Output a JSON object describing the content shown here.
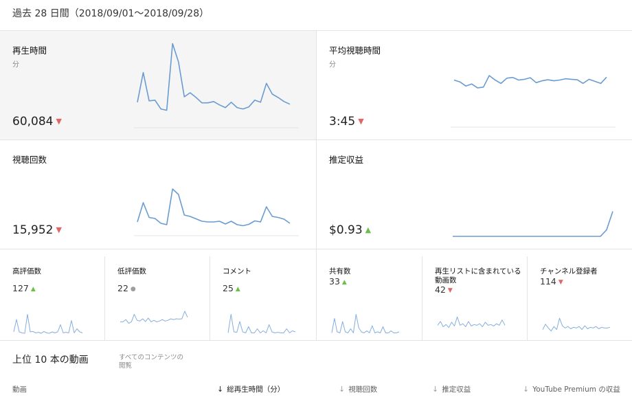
{
  "period": "過去 28 日間（2018/09/01〜2018/09/28）",
  "cards": [
    {
      "title": "再生時間",
      "unit": "分",
      "value": "60,084",
      "trend": "down"
    },
    {
      "title": "平均視聴時間",
      "unit": "分",
      "value": "3:45",
      "trend": "down"
    },
    {
      "title": "視聴回数",
      "unit": "",
      "value": "15,952",
      "trend": "down"
    },
    {
      "title": "推定収益",
      "unit": "",
      "value": "$0.93",
      "trend": "up"
    }
  ],
  "mini_cards": [
    {
      "title": "高評価数",
      "value": "127",
      "trend": "up"
    },
    {
      "title": "低評価数",
      "value": "22",
      "trend": "neutral"
    },
    {
      "title": "コメント",
      "value": "25",
      "trend": "up"
    },
    {
      "title": "共有数",
      "value": "33",
      "trend": "up"
    },
    {
      "title": "再生リストに含まれている\n動画数",
      "value": "42",
      "trend": "down"
    },
    {
      "title": "チャンネル登録者",
      "value": "114",
      "trend": "down"
    }
  ],
  "sparklines": {
    "watch_time": [
      0.38,
      0.82,
      0.4,
      0.41,
      0.28,
      0.26,
      1.25,
      0.98,
      0.46,
      0.52,
      0.45,
      0.37,
      0.37,
      0.39,
      0.34,
      0.3,
      0.38,
      0.3,
      0.28,
      0.31,
      0.41,
      0.38,
      0.66,
      0.5,
      0.45,
      0.39,
      0.35
    ],
    "avg_view_duration": [
      0.75,
      0.68,
      0.52,
      0.6,
      0.45,
      0.48,
      0.92,
      0.75,
      0.62,
      0.82,
      0.85,
      0.75,
      0.78,
      0.84,
      0.65,
      0.72,
      0.76,
      0.72,
      0.75,
      0.8,
      0.78,
      0.76,
      0.62,
      0.78,
      0.7,
      0.62,
      0.86
    ],
    "views": [
      0.42,
      0.98,
      0.55,
      0.52,
      0.38,
      0.34,
      1.38,
      1.22,
      0.62,
      0.58,
      0.51,
      0.44,
      0.42,
      0.42,
      0.44,
      0.36,
      0.44,
      0.34,
      0.31,
      0.35,
      0.45,
      0.42,
      0.86,
      0.58,
      0.55,
      0.5,
      0.38
    ],
    "revenue": [
      0,
      0,
      0,
      0,
      0,
      0,
      0,
      0,
      0,
      0,
      0,
      0,
      0,
      0,
      0,
      0,
      0,
      0,
      0,
      0,
      0,
      0,
      0,
      0,
      0,
      0.18,
      0.7
    ],
    "likes": [
      0.1,
      0.7,
      0.1,
      0.05,
      0.03,
      0.95,
      0.1,
      0.12,
      0.05,
      0.08,
      0.03,
      0.12,
      0.05,
      0.03,
      0.1,
      0.05,
      0.1,
      0.45,
      0.05,
      0.08,
      0.05,
      0.65,
      0.05,
      0.25,
      0.1,
      0.05
    ],
    "dislikes": [
      0.3,
      0.3,
      0.45,
      0.2,
      0.3,
      0.8,
      0.4,
      0.35,
      0.5,
      0.32,
      0.55,
      0.3,
      0.4,
      0.3,
      0.35,
      0.45,
      0.35,
      0.4,
      0.5,
      0.45,
      0.5,
      0.48,
      0.5,
      1.0,
      0.6
    ],
    "comments": [
      0.05,
      0.95,
      0.1,
      0.08,
      0.6,
      0.1,
      0.05,
      0.35,
      0.05,
      0.05,
      0.25,
      0.05,
      0.15,
      0.05,
      0.45,
      0.1,
      0.05,
      0.08,
      0.05,
      0.05,
      0.25,
      0.05,
      0.15,
      0.1
    ],
    "shares": [
      0.05,
      0.75,
      0.1,
      0.05,
      0.6,
      0.1,
      0.05,
      0.25,
      0.05,
      0.95,
      0.3,
      0.1,
      0.05,
      0.15,
      0.05,
      0.4,
      0.05,
      0.1,
      0.05,
      0.35,
      0.05,
      0.05,
      0.15,
      0.05,
      0.05,
      0.1
    ],
    "playlist_adds": [
      0.3,
      0.55,
      0.2,
      0.35,
      0.15,
      0.5,
      0.25,
      0.85,
      0.3,
      0.4,
      0.2,
      0.55,
      0.25,
      0.35,
      0.3,
      0.4,
      0.2,
      0.5,
      0.3,
      0.35,
      0.25,
      0.4,
      0.3,
      0.65,
      0.3
    ],
    "subscribers": [
      0.2,
      0.55,
      0.3,
      0.1,
      0.4,
      0.2,
      0.95,
      0.45,
      0.3,
      0.4,
      0.25,
      0.35,
      0.3,
      0.4,
      0.2,
      0.45,
      0.25,
      0.35,
      0.3,
      0.4,
      0.25,
      0.35,
      0.3,
      0.3,
      0.35
    ]
  },
  "top_section": {
    "title": "上位 10 本の動画",
    "scope": "すべてのコンテンツの\n閲覧"
  },
  "table_headers": [
    {
      "label": "動画",
      "arrow": ""
    },
    {
      "label": "総再生時間（分）",
      "arrow": "↓"
    },
    {
      "label": "視聴回数",
      "arrow": "↓"
    },
    {
      "label": "推定収益",
      "arrow": "↓"
    },
    {
      "label": "YouTube Premium の収益",
      "arrow": "↓"
    }
  ],
  "colors": {
    "line": "#6a9bd0",
    "up": "#6abf4b",
    "down": "#e06666",
    "active_bg": "#f5f5f5"
  }
}
